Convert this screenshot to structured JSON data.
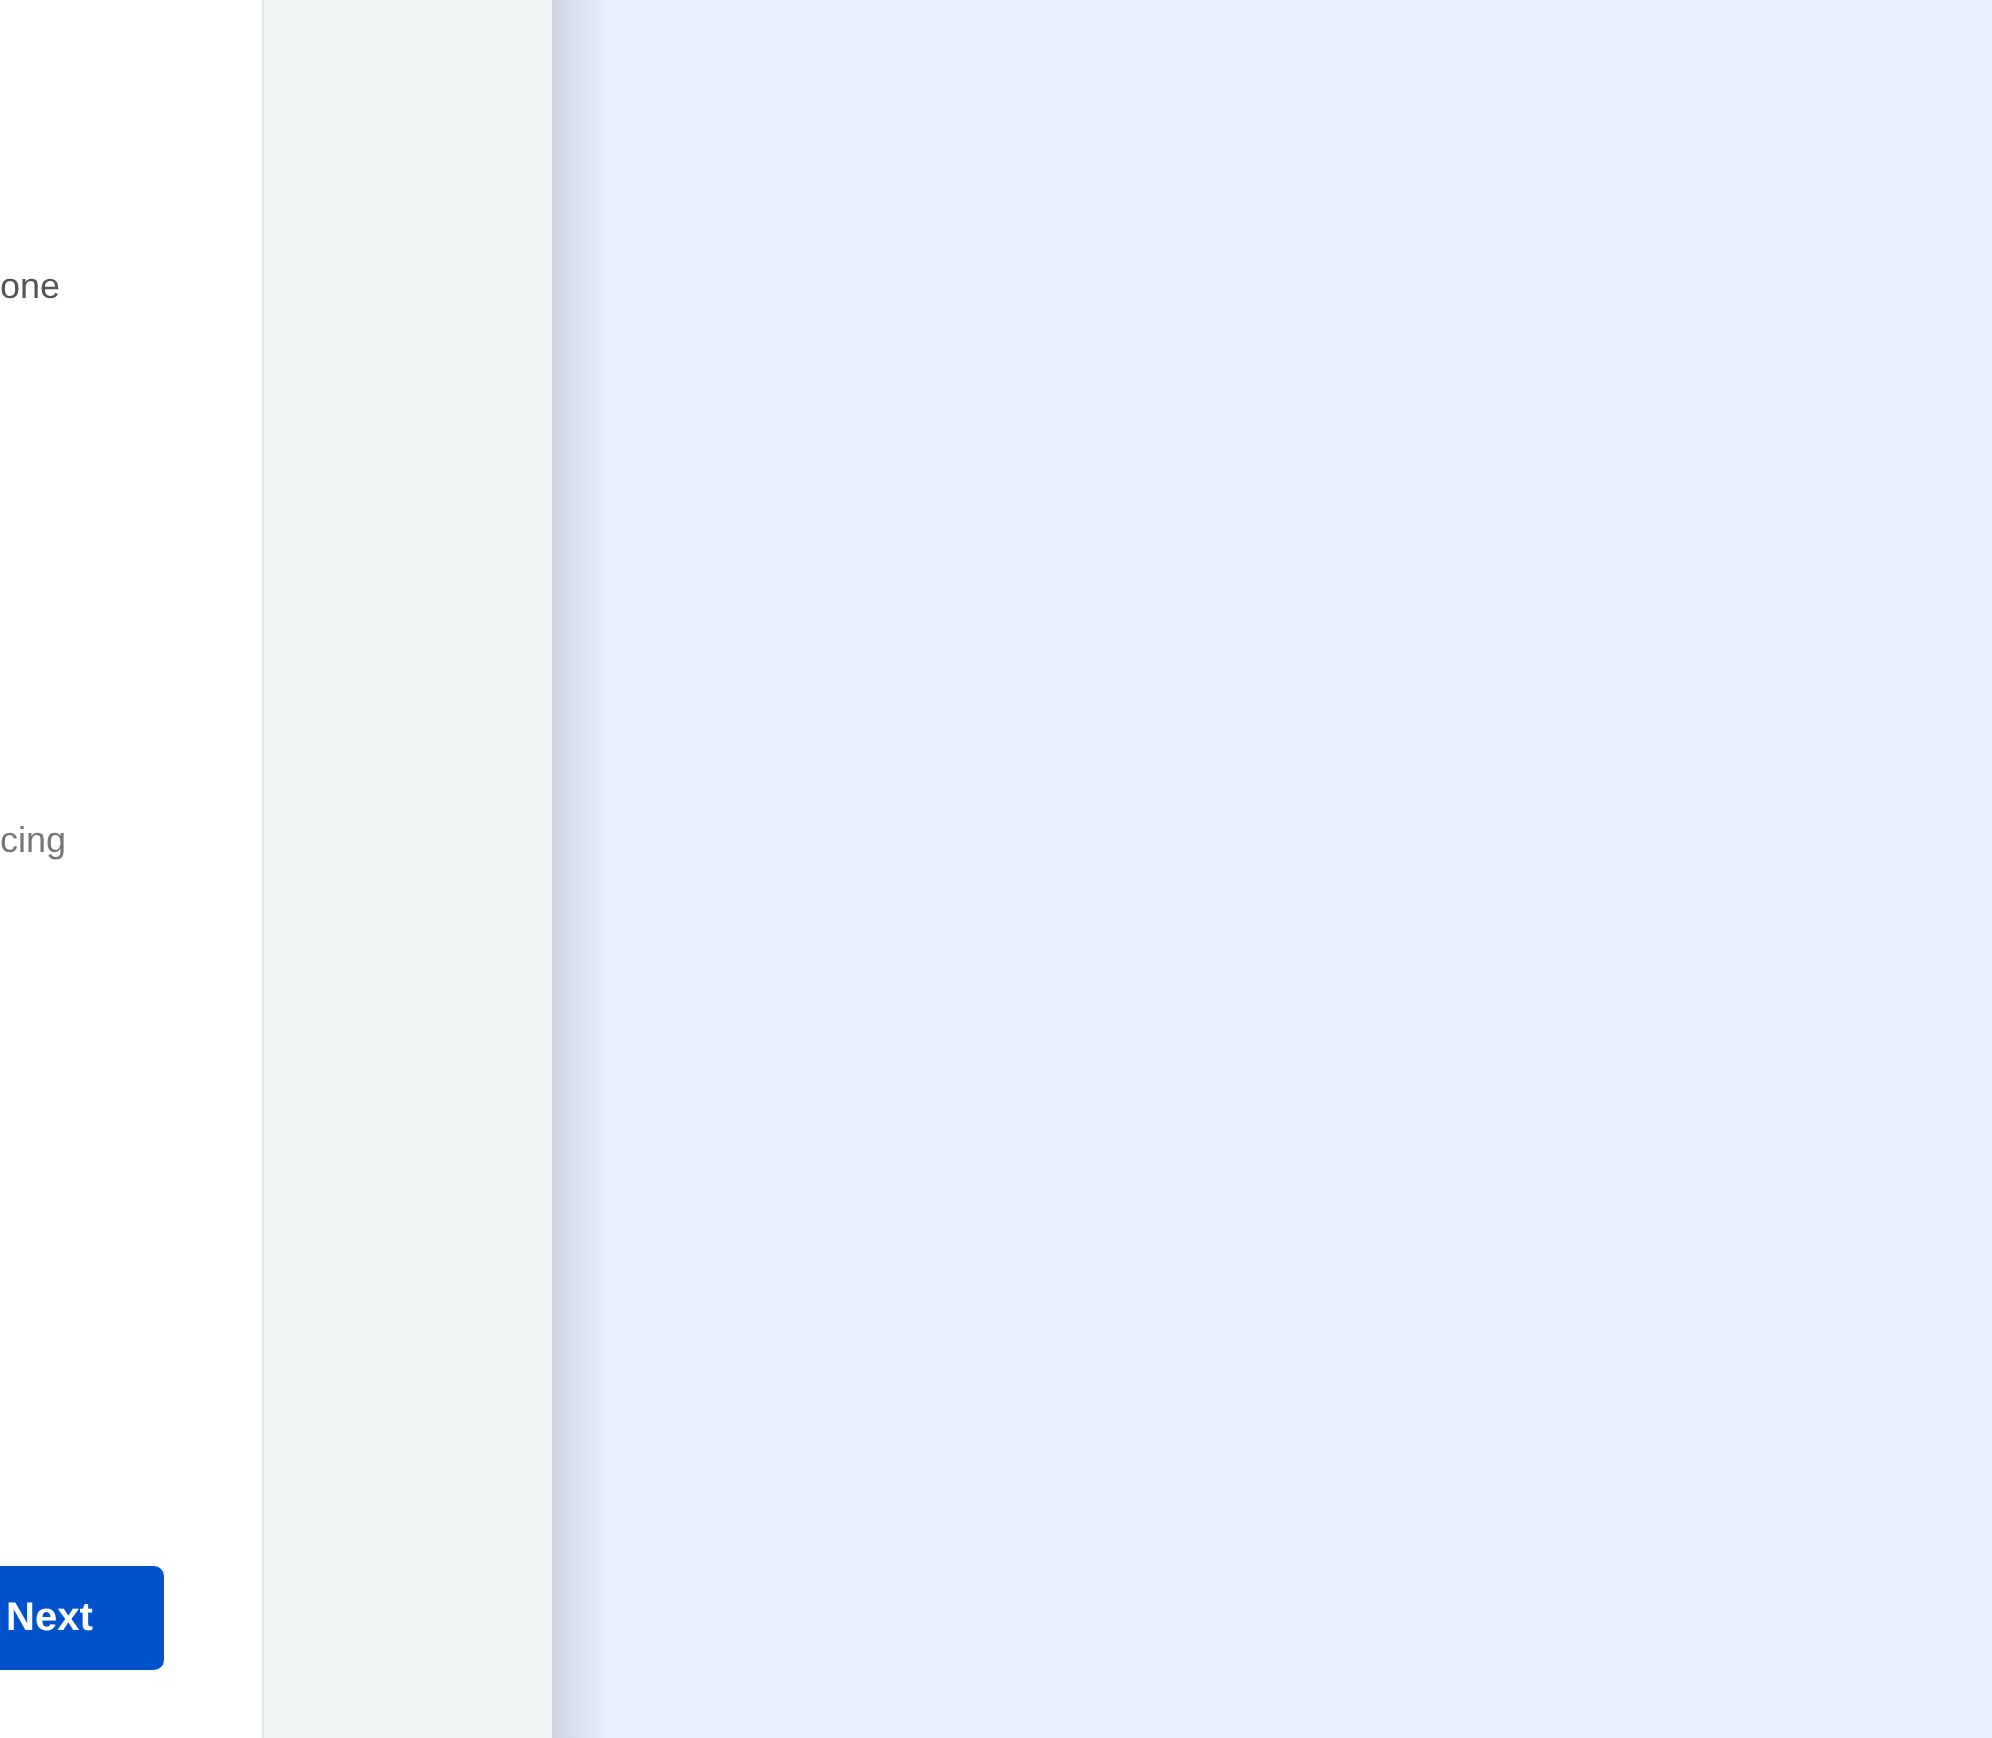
{
  "texts": [
    {
      "text": "one"
    },
    {
      "text": "cing"
    }
  ],
  "next_button": {
    "label": "Next"
  }
}
